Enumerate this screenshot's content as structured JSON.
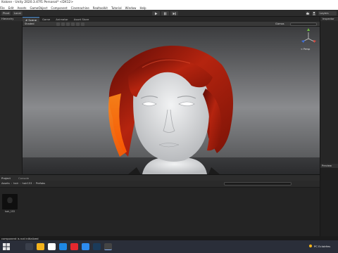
{
  "window": {
    "title": "ltalone - Unity 2020.3.47f1 Personal* <DX12>",
    "menu": [
      "File",
      "Edit",
      "Assets",
      "GameObject",
      "Component",
      "Cinemachine",
      "Realtoolkit",
      "Tutorial",
      "Window",
      "Help"
    ]
  },
  "toolbar": {
    "hand_tool": "Pivot",
    "space_toggle": "Local",
    "buttons": [
      "play-icon",
      "pause-icon",
      "step-icon",
      "cloud-icon",
      "account-icon",
      "layers-icon"
    ],
    "layers_label": "Layers",
    "layout_label": "Layout"
  },
  "hierarchy": {
    "tab": "Hierarchy"
  },
  "scene_tabs": [
    {
      "label": "# Scene",
      "active": true
    },
    {
      "label": "Game",
      "active": false
    },
    {
      "label": "Animator",
      "active": false
    },
    {
      "label": "Asset Store",
      "active": false
    }
  ],
  "scene_toolbar": {
    "shading_mode": "Shaded",
    "gizmos_label": "Gizmos",
    "search_placeholder": "All",
    "perspective_label": "< Persp"
  },
  "inspector": {
    "tab": "Inspector"
  },
  "preview": {
    "tab": "Preview"
  },
  "project": {
    "tabs": [
      "Project",
      "Console"
    ],
    "breadcrumb": [
      "Assets",
      "hair",
      "hair153",
      "Prefabs"
    ],
    "search_placeholder": "",
    "assets": [
      {
        "name": "hair_153"
      }
    ]
  },
  "status": {
    "message": "component is not initialized"
  },
  "taskbar": {
    "apps": [
      {
        "icon": "search-icon",
        "color": "#3a3f4b"
      },
      {
        "icon": "file-explorer-icon",
        "color": "#f3b21b"
      },
      {
        "icon": "chrome-icon",
        "color": "#ffffff"
      },
      {
        "icon": "store-icon",
        "color": "#1e88e5"
      },
      {
        "icon": "opera-icon",
        "color": "#e5282e"
      },
      {
        "icon": "notepad-icon",
        "color": "#2d8cf0"
      },
      {
        "icon": "steam-icon",
        "color": "#1b3b5a"
      },
      {
        "icon": "unity-icon",
        "color": "#444444",
        "active": true
      }
    ],
    "tray_text": "PC  Eclairées"
  },
  "colors": {
    "accent": "#4a8fd4",
    "hair": "#b5240f",
    "skin": "#e8e9ea"
  }
}
